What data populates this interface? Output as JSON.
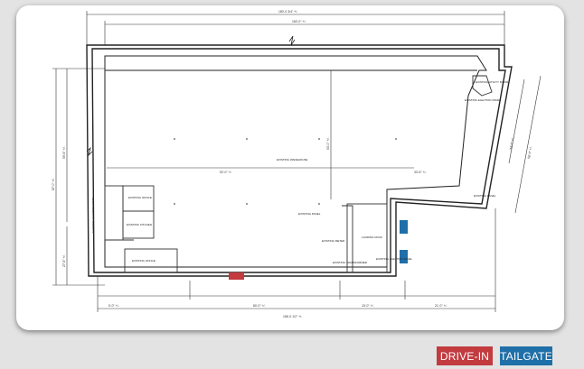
{
  "legend": {
    "drive_in": {
      "label": "DRIVE-IN",
      "color": "#c23b3f"
    },
    "tailgate": {
      "label": "TAILGATE",
      "color": "#1f6fa8"
    }
  },
  "plan": {
    "dimensions": {
      "top_overall": "180'-0 3/4\" +/-",
      "top_inner": "160'-0\" +/-",
      "mid_left": "92'-0\" +/-",
      "mid_right": "33'-6\" +/-",
      "left_overall": "87'-0\" +/-",
      "left_upper": "59'-6\" +/-",
      "left_lower": "27'-6\" +/-",
      "right_upper": "34'-0\" +/-",
      "right_diag": "58'-0\" +/-",
      "bottom_1": "5'-0\" +/-",
      "bottom_2": "80'-0\" +/-",
      "bottom_3": "15'-0\" +/-",
      "bottom_4": "21'-0\" +/-",
      "bottom_overall": "156'-0 1/2\" +/-",
      "inner_vertical": "53'-0\" +/-"
    },
    "rooms": {
      "warehouse": "EXISTING WAREHOUSE",
      "office_1": "EXISTING OFFICE",
      "kitchen": "EXISTING KITCHEN",
      "office_2": "EXISTING OFFICE",
      "utility": "EXISTING UTILITY ROOM",
      "loading": "LOADING DOCK"
    },
    "notes": {
      "elec_panel_top": "EXISTING ELECTRIC PANEL",
      "elec_panel_left": "EXISTING ELECTRIC PANEL",
      "elec_panel_mid": "EXISTING PANEL",
      "meter": "EXISTING METER",
      "transformer": "EXISTING TRANSFORMER",
      "elec_panel_dock": "EXISTING ELECTRIC PANEL",
      "elec_panel_side": "EXISTING PANEL"
    }
  }
}
